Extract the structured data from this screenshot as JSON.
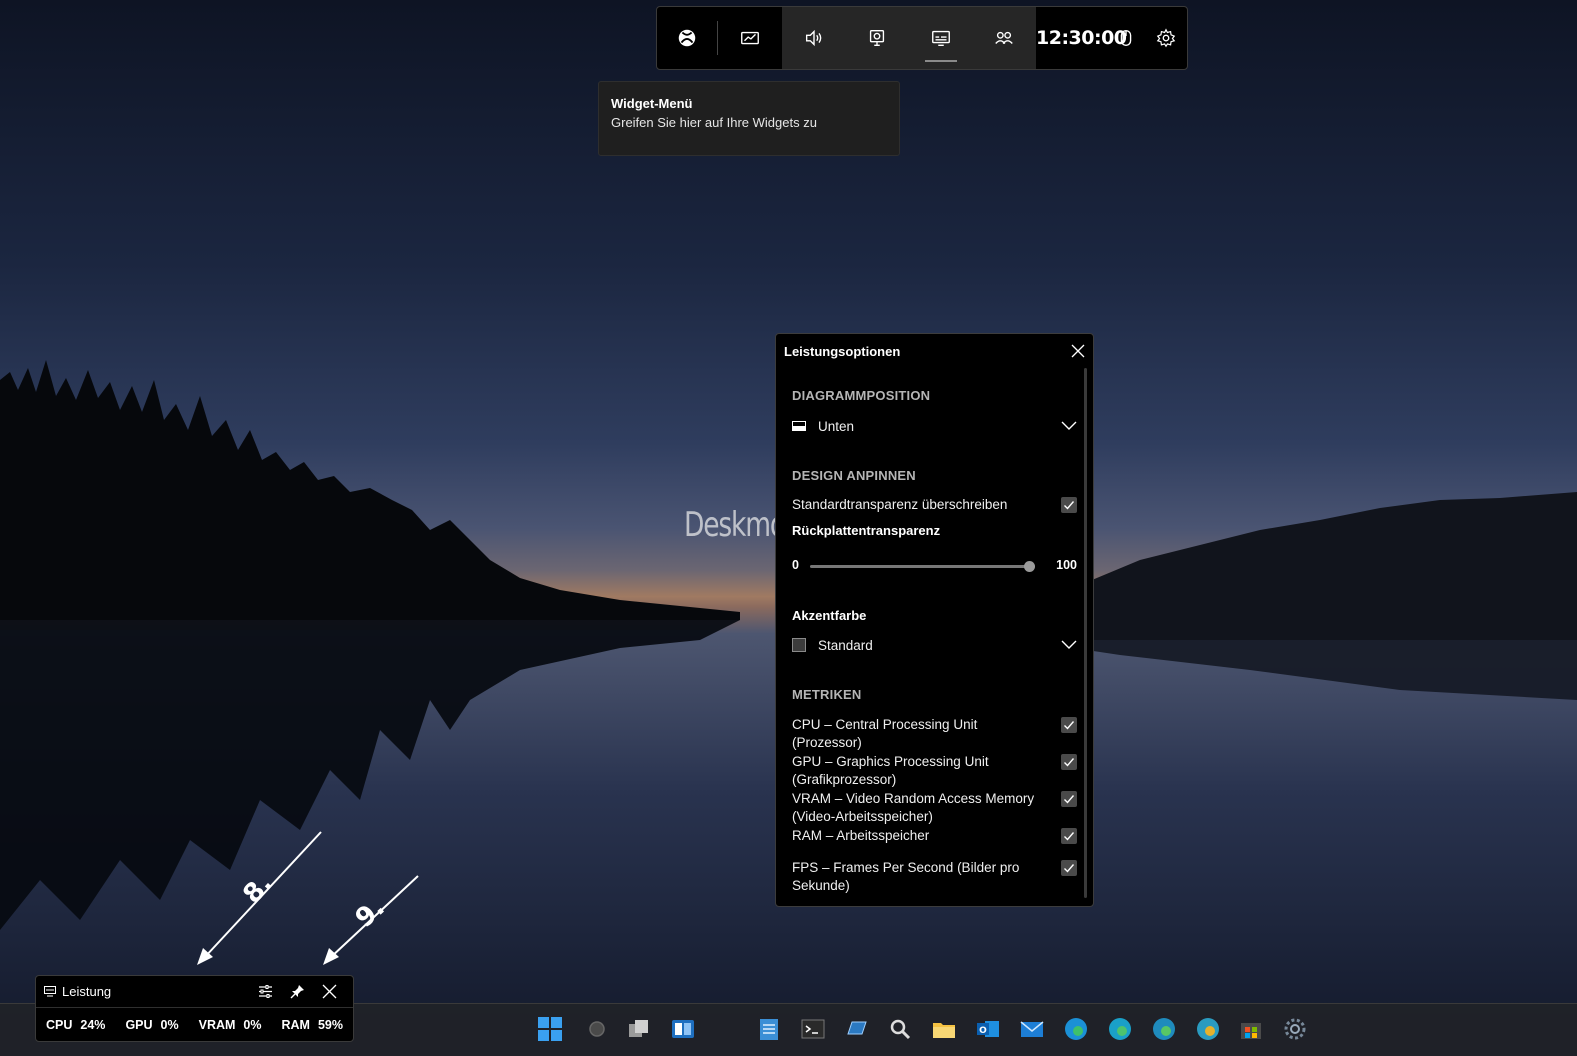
{
  "gamebar": {
    "clock": "12:30:00",
    "buttons": [
      "xbox-icon",
      "widget-menu-icon",
      "audio-icon",
      "capture-icon",
      "performance-icon",
      "xbox-social-icon",
      "mouse-icon",
      "settings-icon"
    ]
  },
  "tooltip": {
    "title": "Widget-Menü",
    "text": "Greifen Sie hier auf Ihre Widgets zu"
  },
  "watermark": "Deskmodder.de",
  "options_panel": {
    "title": "Leistungsoptionen",
    "sections": {
      "chart_position": {
        "heading": "DIAGRAMMPOSITION",
        "selected": "Unten"
      },
      "design": {
        "heading": "DESIGN ANPINNEN",
        "override_label": "Standardtransparenz überschreiben",
        "override_checked": true,
        "transparency_label": "Rückplattentransparenz",
        "slider_min": "0",
        "slider_max": "100",
        "slider_value": 100,
        "accent_label": "Akzentfarbe",
        "accent_selected": "Standard"
      },
      "metrics": {
        "heading": "METRIKEN",
        "items": [
          {
            "line1": "CPU – Central Processing Unit",
            "line2": "(Prozessor)",
            "checked": true
          },
          {
            "line1": "GPU – Graphics Processing Unit",
            "line2": "(Grafikprozessor)",
            "checked": true
          },
          {
            "line1": "VRAM – Video Random Access Memory",
            "line2": "(Video-Arbeitsspeicher)",
            "checked": true
          },
          {
            "line1": "RAM – Arbeitsspeicher",
            "line2": "",
            "checked": true
          },
          {
            "line1": "FPS – Frames Per Second (Bilder pro",
            "line2": "Sekunde)",
            "checked": true
          }
        ]
      }
    }
  },
  "perf_widget": {
    "title": "Leistung",
    "metrics": [
      {
        "key": "CPU",
        "value": "24%"
      },
      {
        "key": "GPU",
        "value": "0%"
      },
      {
        "key": "VRAM",
        "value": "0%"
      },
      {
        "key": "RAM",
        "value": "59%"
      }
    ]
  },
  "annotations": {
    "arrow_8": "8.",
    "arrow_9": "9."
  },
  "taskbar": {
    "icons": [
      "start-icon",
      "cortana-icon",
      "task-view-icon",
      "widgets-icon",
      "notepad-icon",
      "terminal-icon",
      "remote-icon",
      "search-icon",
      "file-explorer-icon",
      "outlook-icon",
      "mail-icon",
      "edge-icon",
      "edge-beta-icon",
      "edge-dev-icon",
      "edge-canary-icon",
      "store-icon",
      "settings-icon"
    ]
  }
}
